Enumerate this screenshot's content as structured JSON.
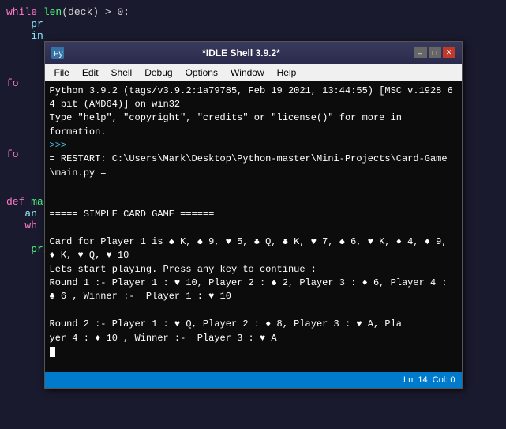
{
  "window": {
    "title": "*IDLE Shell 3.9.2*",
    "icon": "python"
  },
  "titlebar": {
    "title": "*IDLE Shell 3.9.2*",
    "minimize_label": "–",
    "maximize_label": "□",
    "close_label": "✕"
  },
  "menubar": {
    "items": [
      "File",
      "Edit",
      "Shell",
      "Debug",
      "Options",
      "Window",
      "Help"
    ]
  },
  "shell": {
    "line1": "Python 3.9.2 (tags/v3.9.2:1a79785, Feb 19 2021, 13:44:55) [MSC v.1928 64 bit (AMD64)] on win32",
    "line2": "Type \"help\", \"copyright\", \"credits\" or \"license()\" for more in",
    "line3": "formation.",
    "prompt": ">>>",
    "restart": "= RESTART: C:\\Users\\Mark\\Desktop\\Python-master\\Mini-Projects\\Card-Game\\main.py =",
    "blank1": "",
    "blank2": "",
    "title_game": "===== SIMPLE CARD GAME ======",
    "blank3": "",
    "cards": "Card for Player 1 is ♠ K, ♠ 9, ♥ 5, ♣ Q, ♣ K, ♥ 7, ♠ 6, ♥ K, ♦ 4, ♦ 9, ♦ K, ♥ Q, ♥ 10",
    "lets_start": "Lets start playing. Press any key to continue :",
    "round1": "Round 1 :- Player 1 : ♥ 10, Player 2 : ♠ 2, Player 3 : ♦ 6, Player 4 : ♣ 6 , Winner :-  Player 1 : ♥ 10",
    "blank4": "",
    "round2a": "Round 2 :- Player 1 : ♥ Q, Player 2 : ♦ 8, Player 3 : ♥ A, Pla",
    "round2b": "yer 4 : ♦ 10 , Winner :-  Player 3 : ♥ A"
  },
  "statusbar": {
    "ln": "Ln: 14",
    "col": "Col: 0"
  },
  "bg_code": {
    "lines": [
      "while len(deck) > 0:",
      "    ...",
      "    ...",
      "",
      "",
      "",
      "fo                                                        hand.g",
      "",
      "",
      "",
      "",
      "",
      "fo",
      "",
      "",
      "",
      "def ma",
      "   an",
      "   wh"
    ]
  },
  "colors": {
    "accent": "#007acc",
    "bg_dark": "#1a1a2e",
    "shell_bg": "#0c0c0c",
    "titlebar_bg": "#2a2a4c"
  }
}
